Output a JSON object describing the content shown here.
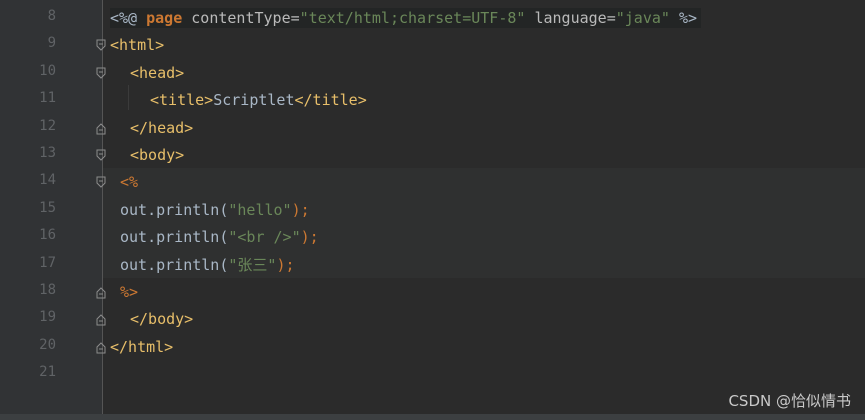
{
  "colors": {
    "background": "#2b2b2b",
    "gutter": "#313335",
    "line_number": "#606366",
    "tag": "#e8bf6a",
    "string": "#6a8759",
    "keyword": "#cc7832",
    "text": "#a9b7c6"
  },
  "lines": [
    {
      "num": "8",
      "parts": [
        {
          "t": "<%@ ",
          "c": "t-plain"
        },
        {
          "t": "page",
          "c": "t-kw"
        },
        {
          "t": " contentType=",
          "c": "t-attr"
        },
        {
          "t": "\"text/html;charset=UTF-8\"",
          "c": "t-str"
        },
        {
          "t": " language=",
          "c": "t-attr"
        },
        {
          "t": "\"java\"",
          "c": "t-str"
        },
        {
          "t": " %>",
          "c": "t-plain"
        }
      ]
    },
    {
      "num": "9",
      "parts": [
        {
          "t": "<html>",
          "c": "t-tag"
        }
      ]
    },
    {
      "num": "10",
      "parts": [
        {
          "t": "<head>",
          "c": "t-tag"
        }
      ]
    },
    {
      "num": "11",
      "parts": [
        {
          "t": "<title>",
          "c": "t-tag"
        },
        {
          "t": "Scriptlet",
          "c": "t-plain"
        },
        {
          "t": "</title>",
          "c": "t-tag"
        }
      ]
    },
    {
      "num": "12",
      "parts": [
        {
          "t": "</head>",
          "c": "t-tag"
        }
      ]
    },
    {
      "num": "13",
      "parts": [
        {
          "t": "<body>",
          "c": "t-tag"
        }
      ]
    },
    {
      "num": "14",
      "parts": [
        {
          "t": "<%",
          "c": "t-scriptdelim"
        }
      ]
    },
    {
      "num": "15",
      "parts": [
        {
          "t": "out.println(",
          "c": "t-plain"
        },
        {
          "t": "\"hello\"",
          "c": "t-str"
        },
        {
          "t": ");",
          "c": "t-semi"
        }
      ]
    },
    {
      "num": "16",
      "parts": [
        {
          "t": "out.println(",
          "c": "t-plain"
        },
        {
          "t": "\"<br />\"",
          "c": "t-str"
        },
        {
          "t": ");",
          "c": "t-semi"
        }
      ]
    },
    {
      "num": "17",
      "parts": [
        {
          "t": "out.println(",
          "c": "t-plain"
        },
        {
          "t": "\"张三\"",
          "c": "t-str"
        },
        {
          "t": ");",
          "c": "t-semi"
        }
      ]
    },
    {
      "num": "18",
      "parts": [
        {
          "t": "%>",
          "c": "t-scriptdelim"
        }
      ]
    },
    {
      "num": "19",
      "parts": [
        {
          "t": "</body>",
          "c": "t-tag"
        }
      ]
    },
    {
      "num": "20",
      "parts": [
        {
          "t": "</html>",
          "c": "t-tag"
        }
      ]
    },
    {
      "num": "21",
      "parts": []
    }
  ],
  "watermark": "CSDN @恰似情书"
}
